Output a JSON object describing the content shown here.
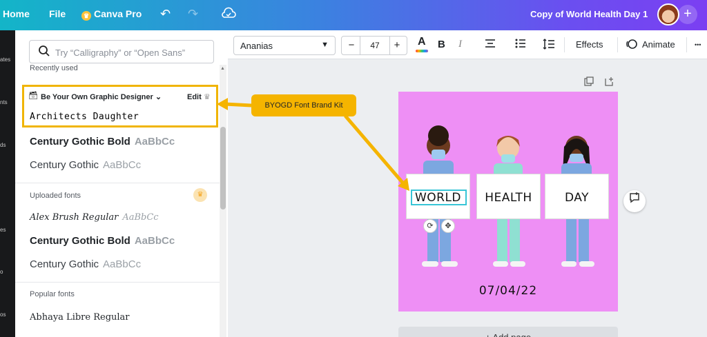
{
  "topbar": {
    "home": "Home",
    "file": "File",
    "canva_pro": "Canva Pro",
    "doc_title": "Copy of World Health Day 1",
    "plus": "+"
  },
  "rail": {
    "labels": [
      "ates",
      "nts",
      "ds",
      "es",
      "o",
      "os"
    ]
  },
  "panel": {
    "search_placeholder": "Try “Calligraphy” or “Open Sans”",
    "recently_used_label": "Recently used",
    "brand_kit_name": "Be Your Own Graphic Designer",
    "brand_kit_edit": "Edit",
    "recent_fonts": [
      {
        "name": "Architects Daughter",
        "sample": ""
      },
      {
        "name": "Century Gothic Bold",
        "sample": "AaBbCc"
      },
      {
        "name": "Century Gothic",
        "sample": "AaBbCc"
      }
    ],
    "uploaded_label": "Uploaded fonts",
    "uploaded_fonts": [
      {
        "name": "Alex Brush Regular",
        "sample": "AaBbCc"
      },
      {
        "name": "Century Gothic Bold",
        "sample": "AaBbCc"
      },
      {
        "name": "Century Gothic",
        "sample": "AaBbCc"
      }
    ],
    "popular_label": "Popular fonts",
    "popular_fonts": [
      {
        "name": "Abhaya Libre Regular"
      }
    ]
  },
  "toolbar": {
    "font_name": "Ananias",
    "font_size": "47",
    "minus": "−",
    "plus": "+",
    "color_glyph": "A",
    "bold_glyph": "B",
    "italic_glyph": "I",
    "effects": "Effects",
    "animate": "Animate",
    "more": "•••"
  },
  "canvas": {
    "signs": [
      "WORLD",
      "HEALTH",
      "DAY"
    ],
    "date": "07/04/22",
    "add_page": "+ Add page"
  },
  "callout": {
    "text": "BYOGD Font Brand Kit"
  },
  "colors": {
    "accent": "#f5b400",
    "page_bg": "#ee8ff5",
    "selection": "#37c5d6"
  },
  "icons": {
    "undo": "undo-icon",
    "redo": "redo-icon",
    "cloud_saved": "cloud-check-icon",
    "search": "search-icon"
  }
}
